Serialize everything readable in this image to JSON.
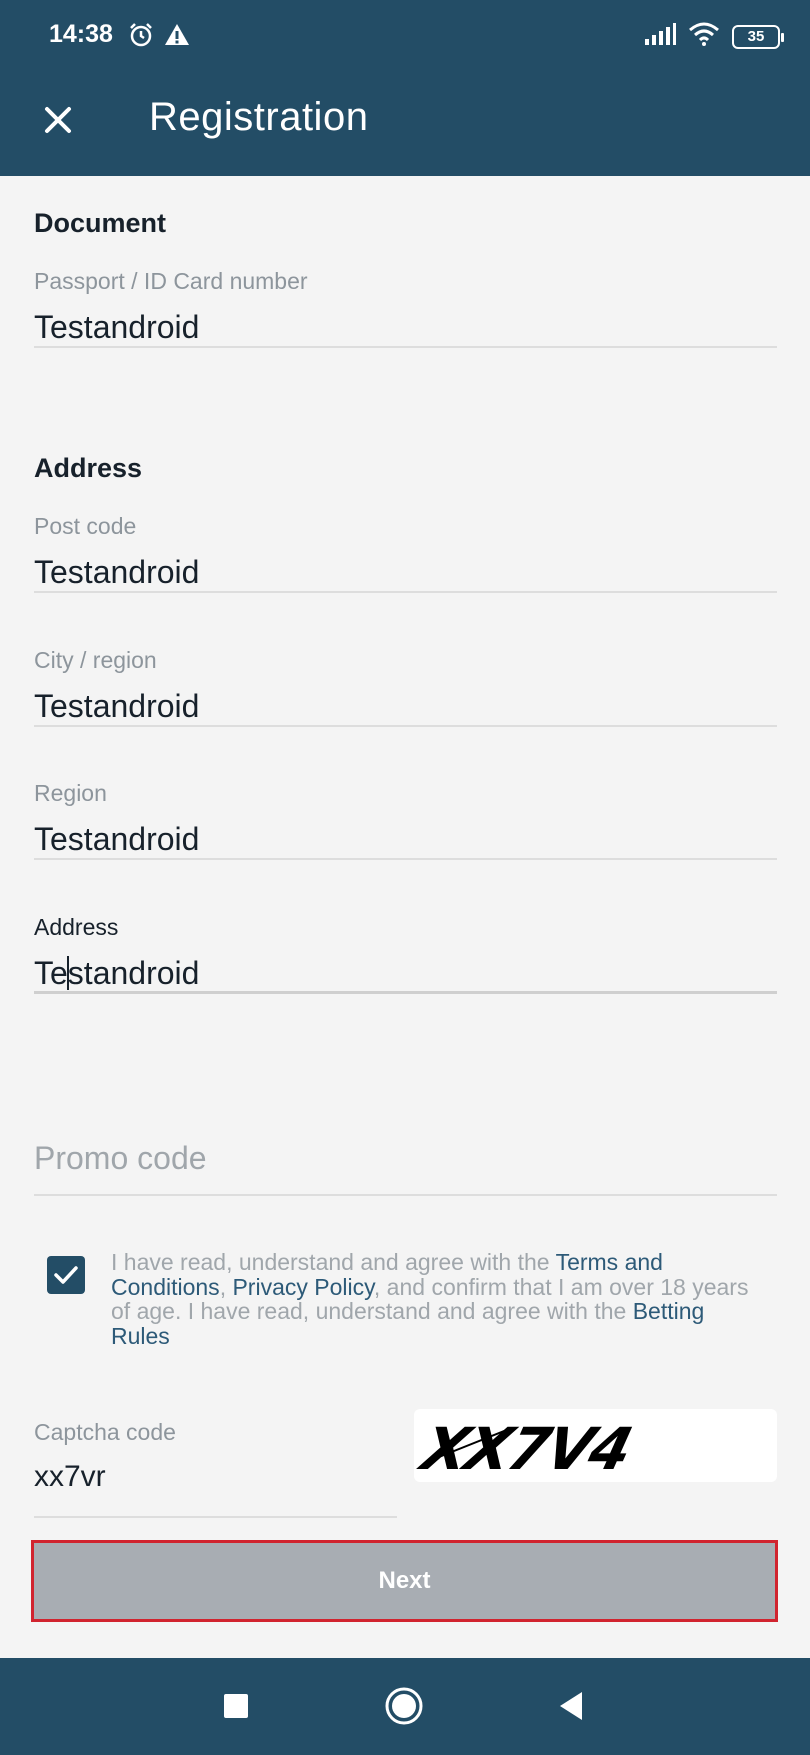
{
  "status_bar": {
    "time": "14:38",
    "battery": "35"
  },
  "header": {
    "title": "Registration"
  },
  "document": {
    "section_title": "Document",
    "passport": {
      "label": "Passport / ID Card number",
      "value": "Testandroid"
    }
  },
  "address_section": {
    "section_title": "Address",
    "post_code": {
      "label": "Post code",
      "value": "Testandroid"
    },
    "city": {
      "label": "City / region",
      "value": "Testandroid"
    },
    "region": {
      "label": "Region",
      "value": "Testandroid"
    },
    "address": {
      "label": "Address",
      "value_before_cursor": "Te",
      "value_after_cursor": "standroid"
    }
  },
  "promo": {
    "placeholder": "Promo code"
  },
  "agreement": {
    "checked": true,
    "text_1": "I have read, understand and agree with the ",
    "link_terms": "Terms and Conditions",
    "text_2": ", ",
    "link_privacy": "Privacy Policy",
    "text_3": ", and confirm that I am over 18 years of age. I have read, understand and agree with the ",
    "link_betting": "Betting Rules"
  },
  "captcha": {
    "label": "Captcha code",
    "value": "xx7vr",
    "image_text": "XX7V4"
  },
  "next_button": {
    "label": "Next"
  },
  "colors": {
    "primary": "#234d66",
    "link": "#2d5a78",
    "button_disabled": "#a8adb3",
    "highlight_border": "#d1242f"
  }
}
